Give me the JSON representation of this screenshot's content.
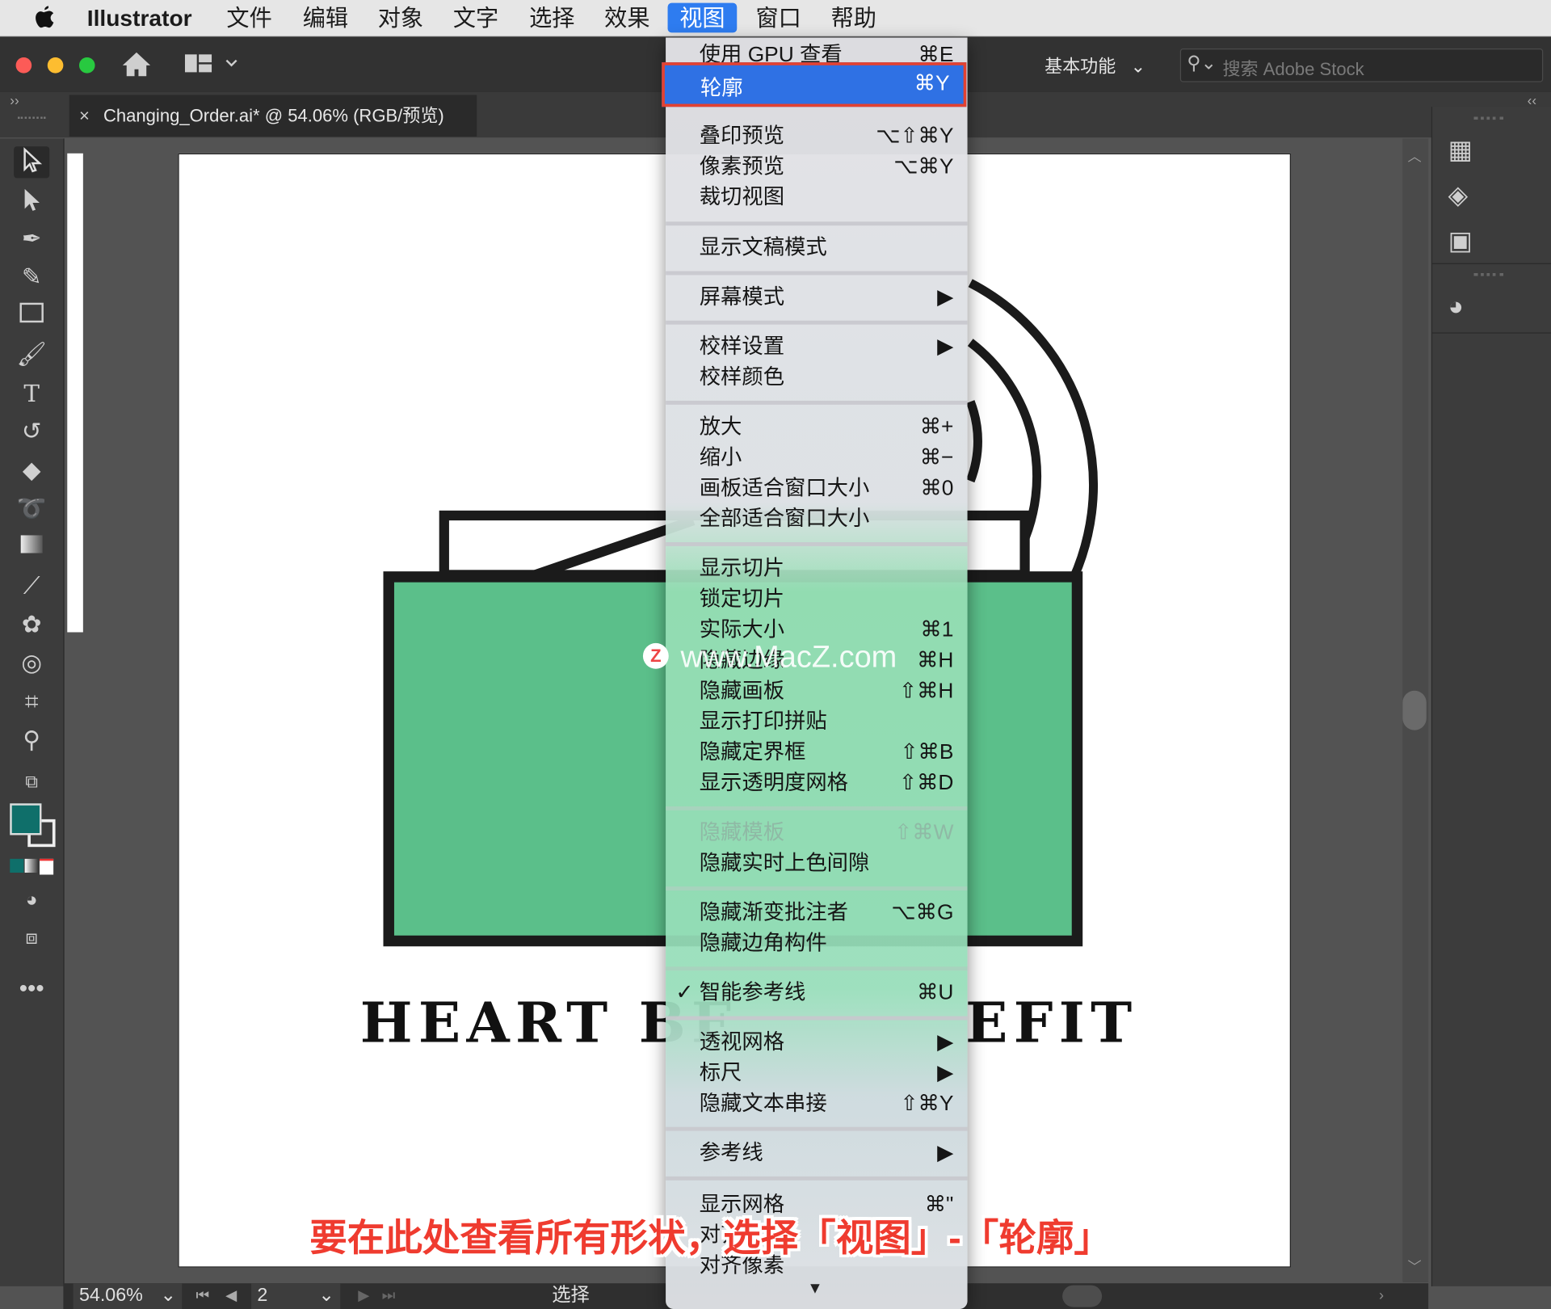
{
  "menubar": {
    "app_name": "Illustrator",
    "items": [
      "文件",
      "编辑",
      "对象",
      "文字",
      "选择",
      "效果",
      "视图",
      "窗口",
      "帮助"
    ]
  },
  "appbar": {
    "workspace": "基本功能",
    "search_placeholder": "搜索 Adobe Stock"
  },
  "document": {
    "tab_title": "Changing_Order.ai* @ 54.06% (RGB/预览)",
    "close_glyph": "×"
  },
  "status": {
    "zoom": "54.06%",
    "artboard_num": "2",
    "tool": "选择"
  },
  "artwork": {
    "headline_left": "HEART BE",
    "headline_right": "EFIT",
    "green": "#5bbf8a"
  },
  "view_menu": {
    "items": [
      {
        "label": "使用 GPU 查看",
        "shortcut": "⌘E"
      },
      {
        "label": "轮廓",
        "shortcut": "⌘Y",
        "highlighted": true
      },
      {
        "label": "叠印预览",
        "shortcut": "⌥⇧⌘Y"
      },
      {
        "label": "像素预览",
        "shortcut": "⌥⌘Y"
      },
      {
        "label": "裁切视图",
        "shortcut": ""
      },
      {
        "label": "显示文稿模式",
        "shortcut": ""
      },
      {
        "label": "屏幕模式",
        "shortcut": "▶"
      },
      {
        "label": "校样设置",
        "shortcut": "▶"
      },
      {
        "label": "校样颜色",
        "shortcut": ""
      },
      {
        "label": "放大",
        "shortcut": "⌘+"
      },
      {
        "label": "缩小",
        "shortcut": "⌘−"
      },
      {
        "label": "画板适合窗口大小",
        "shortcut": "⌘0"
      },
      {
        "label": "全部适合窗口大小",
        "shortcut": ""
      },
      {
        "label": "显示切片",
        "shortcut": ""
      },
      {
        "label": "锁定切片",
        "shortcut": ""
      },
      {
        "label": "实际大小",
        "shortcut": "⌘1"
      },
      {
        "label": "隐藏边缘",
        "shortcut": "⌘H"
      },
      {
        "label": "隐藏画板",
        "shortcut": "⇧⌘H"
      },
      {
        "label": "显示打印拼贴",
        "shortcut": ""
      },
      {
        "label": "隐藏定界框",
        "shortcut": "⇧⌘B"
      },
      {
        "label": "显示透明度网格",
        "shortcut": "⇧⌘D"
      },
      {
        "label": "隐藏模板",
        "shortcut": "⇧⌘W",
        "disabled": true
      },
      {
        "label": "隐藏实时上色间隙",
        "shortcut": ""
      },
      {
        "label": "隐藏渐变批注者",
        "shortcut": "⌥⌘G"
      },
      {
        "label": "隐藏边角构件",
        "shortcut": ""
      },
      {
        "label": "智能参考线",
        "shortcut": "⌘U",
        "checked": true
      },
      {
        "label": "透视网格",
        "shortcut": "▶"
      },
      {
        "label": "标尺",
        "shortcut": "▶"
      },
      {
        "label": "隐藏文本串接",
        "shortcut": "⇧⌘Y"
      },
      {
        "label": "参考线",
        "shortcut": "▶"
      },
      {
        "label": "显示网格",
        "shortcut": "⌘\""
      },
      {
        "label": "对齐网格",
        "shortcut": ""
      },
      {
        "label": "对齐像素",
        "shortcut": ""
      }
    ],
    "check_glyph": "✓",
    "scroll_glyph": "▼"
  },
  "overlay": {
    "watermark": "www.MacZ.com",
    "watermark_logo": "Z",
    "subtitle": "要在此处查看所有形状，选择「视图」-「轮廓」"
  }
}
